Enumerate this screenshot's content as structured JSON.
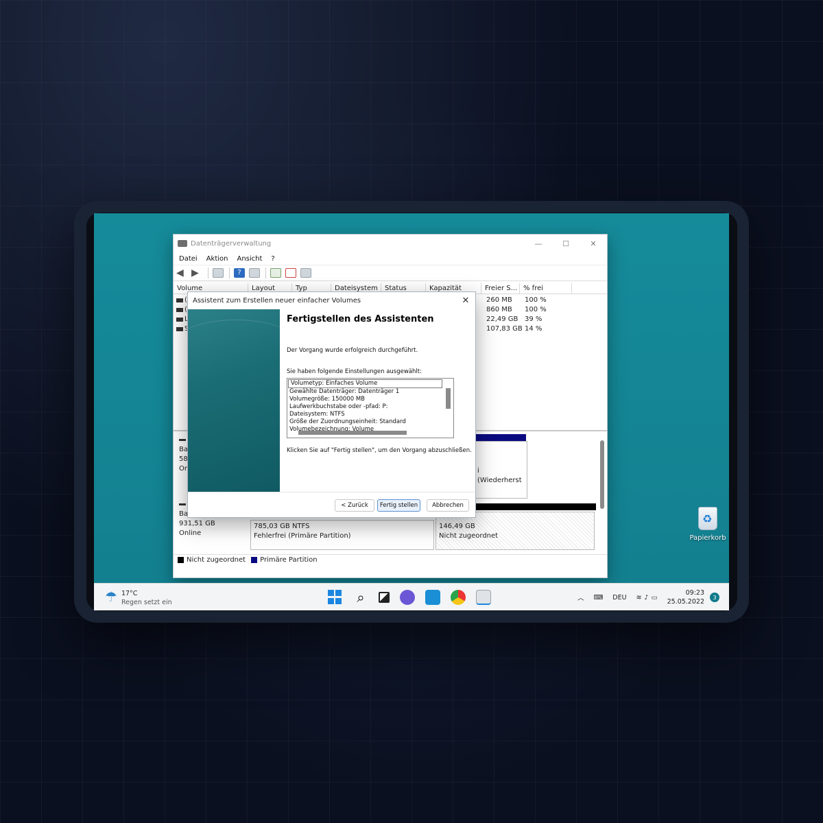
{
  "desktop": {
    "recycle_bin_label": "Papierkorb"
  },
  "window": {
    "title": "Datenträgerverwaltung",
    "controls": {
      "minimize": "—",
      "maximize": "☐",
      "close": "✕"
    },
    "menu": [
      "Datei",
      "Aktion",
      "Ansicht",
      "?"
    ],
    "columns": [
      "Volume",
      "Layout",
      "Typ",
      "Dateisystem",
      "Status",
      "Kapazität",
      "Freier S...",
      "% frei"
    ],
    "volumes": [
      {
        "marker": "(",
        "free": "260 MB",
        "pct": "100 %"
      },
      {
        "marker": "(",
        "free": "860 MB",
        "pct": "100 %"
      },
      {
        "marker": "L",
        "free": "22,49 GB",
        "pct": "39 %"
      },
      {
        "marker": "S",
        "free": "107,83 GB",
        "pct": "14 %"
      }
    ],
    "disks": {
      "disk0": {
        "line1": "Ba",
        "line2": "58,",
        "line3": "On"
      },
      "disk1": {
        "line1": "Ba",
        "line2": "931,51 GB",
        "line3": "Online"
      },
      "recovery_partition": "i (Wiederherst⁠",
      "partition_ntfs": {
        "size": "785,03 GB NTFS",
        "status": "Fehlerfrei (Primäre Partition)"
      },
      "partition_unalloc": {
        "size": "146,49 GB",
        "status": "Nicht zugeordnet"
      }
    },
    "legend": [
      {
        "label": "Nicht zugeordnet",
        "color": "#000000"
      },
      {
        "label": "Primäre Partition",
        "color": "#0a0a80"
      }
    ]
  },
  "wizard": {
    "title": "Assistent zum Erstellen neuer einfacher Volumes",
    "close": "✕",
    "heading": "Fertigstellen des Assistenten",
    "success_text": "Der Vorgang wurde erfolgreich durchgeführt.",
    "settings_intro": "Sie haben folgende Einstellungen ausgewählt:",
    "settings": [
      "Volumetyp: Einfaches Volume",
      "Gewählte Datenträger: Datenträger 1",
      "Volumegröße: 150000 MB",
      "Laufwerkbuchstabe oder -pfad: P:",
      "Dateisystem: NTFS",
      "Größe der Zuordnungseinheit: Standard",
      "Volumebezeichnung: Volume"
    ],
    "finish_hint": "Klicken Sie auf \"Fertig stellen\", um den Vorgang abzuschließen.",
    "buttons": {
      "back": "< Zurück",
      "finish": "Fertig stellen",
      "cancel": "Abbrechen"
    }
  },
  "taskbar": {
    "weather_temp": "17°C",
    "weather_desc": "Regen setzt ein",
    "language": "DEU",
    "time": "09:23",
    "date": "25.05.2022",
    "notification_count": "3"
  }
}
